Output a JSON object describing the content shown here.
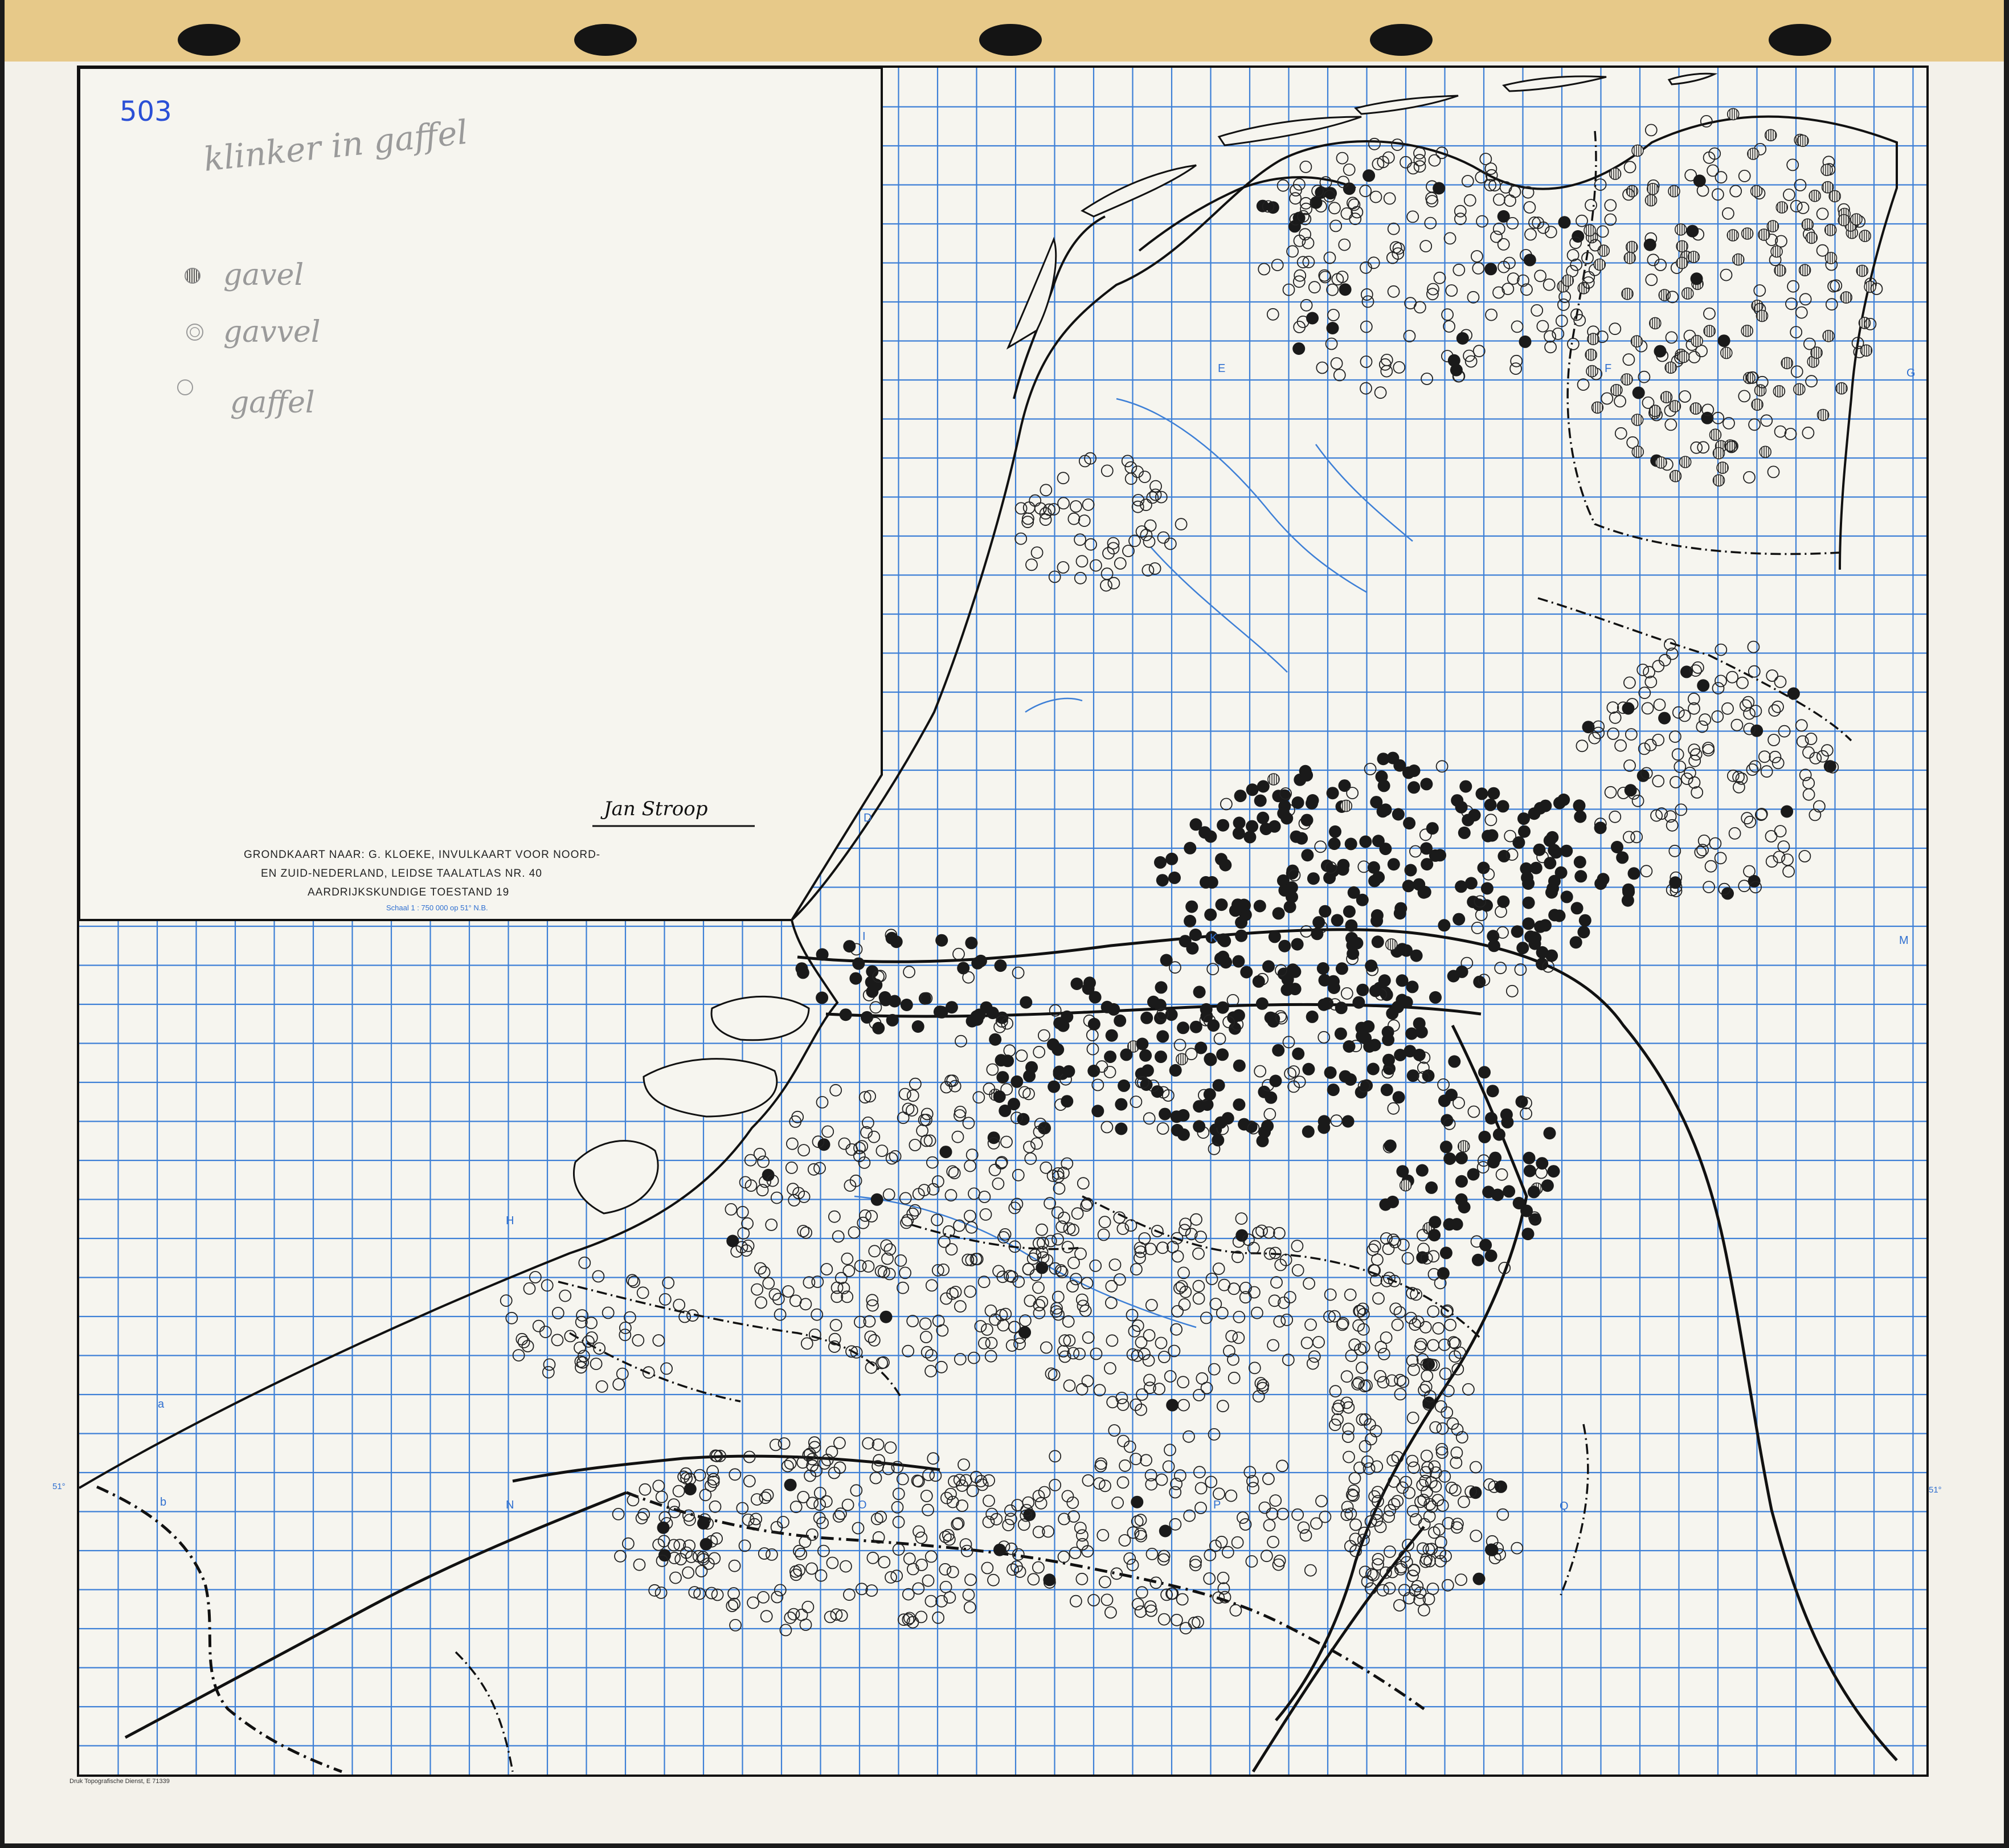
{
  "handwritten": {
    "map_number": "503",
    "title_pencil": "klinker in gaffel"
  },
  "legend": {
    "items": [
      {
        "symbol": "hatched-circle",
        "label": "gavel"
      },
      {
        "symbol": "double-circle",
        "label": "gavvel"
      },
      {
        "symbol": "open-circle",
        "label": "gaffel"
      }
    ]
  },
  "signature": "Jan Stroop",
  "caption": {
    "line1": "GRONDKAART NAAR: G. KLOEKE, INVULKAART VOOR NOORD-",
    "line2": "EN ZUID-NEDERLAND, LEIDSE TAALATLAS NR. 40",
    "line3": "AARDRIJKSKUNDIGE TOESTAND 19",
    "scale": "Schaal 1 : 750 000 op 51° N.B."
  },
  "grid_labels": {
    "E": "E",
    "F": "F",
    "G": "G",
    "D": "D",
    "I": "I",
    "K": "K",
    "M": "M",
    "H": "H",
    "a": "a",
    "b": "b",
    "N": "N",
    "O": "O",
    "P": "P",
    "Q": "Q",
    "lat_left": "51°",
    "lat_right": "51°"
  },
  "printer": "Druk Topografische Dienst, E 71339",
  "colors": {
    "paper": "#f3f1ea",
    "binding": "#e7c989",
    "grid": "#3d7fd6",
    "ink": "#111111",
    "dot_fill": "#1a1a1a",
    "pencil": "#9a9a9a",
    "note_blue": "#2a4fd6"
  }
}
